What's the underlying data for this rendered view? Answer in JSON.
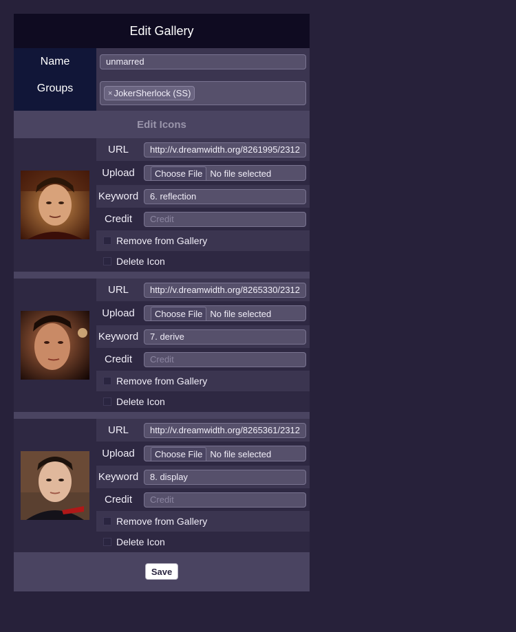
{
  "page": {
    "title": "Edit Gallery"
  },
  "gallery": {
    "name_label": "Name",
    "name_value": "unmarred",
    "groups_label": "Groups",
    "groups": [
      {
        "remove_glyph": "×",
        "label": "JokerSherlock (SS)"
      }
    ]
  },
  "edit_icons": {
    "heading": "Edit Icons",
    "labels": {
      "url": "URL",
      "upload": "Upload",
      "keyword": "Keyword",
      "credit": "Credit",
      "choose_file": "Choose File",
      "no_file": "No file selected",
      "credit_placeholder": "Credit",
      "remove_from_gallery": "Remove from Gallery",
      "delete_icon": "Delete Icon"
    },
    "icons": [
      {
        "url": "http://v.dreamwidth.org/8261995/2312",
        "keyword": "6. reflection",
        "credit": ""
      },
      {
        "url": "http://v.dreamwidth.org/8265330/2312",
        "keyword": "7. derive",
        "credit": ""
      },
      {
        "url": "http://v.dreamwidth.org/8265361/2312",
        "keyword": "8. display",
        "credit": ""
      }
    ]
  },
  "actions": {
    "save_label": "Save"
  },
  "colors": {
    "background": "#27213a",
    "title_bar": "#0f0b21",
    "label_column": "#111638",
    "section_header": "#4a4461"
  }
}
